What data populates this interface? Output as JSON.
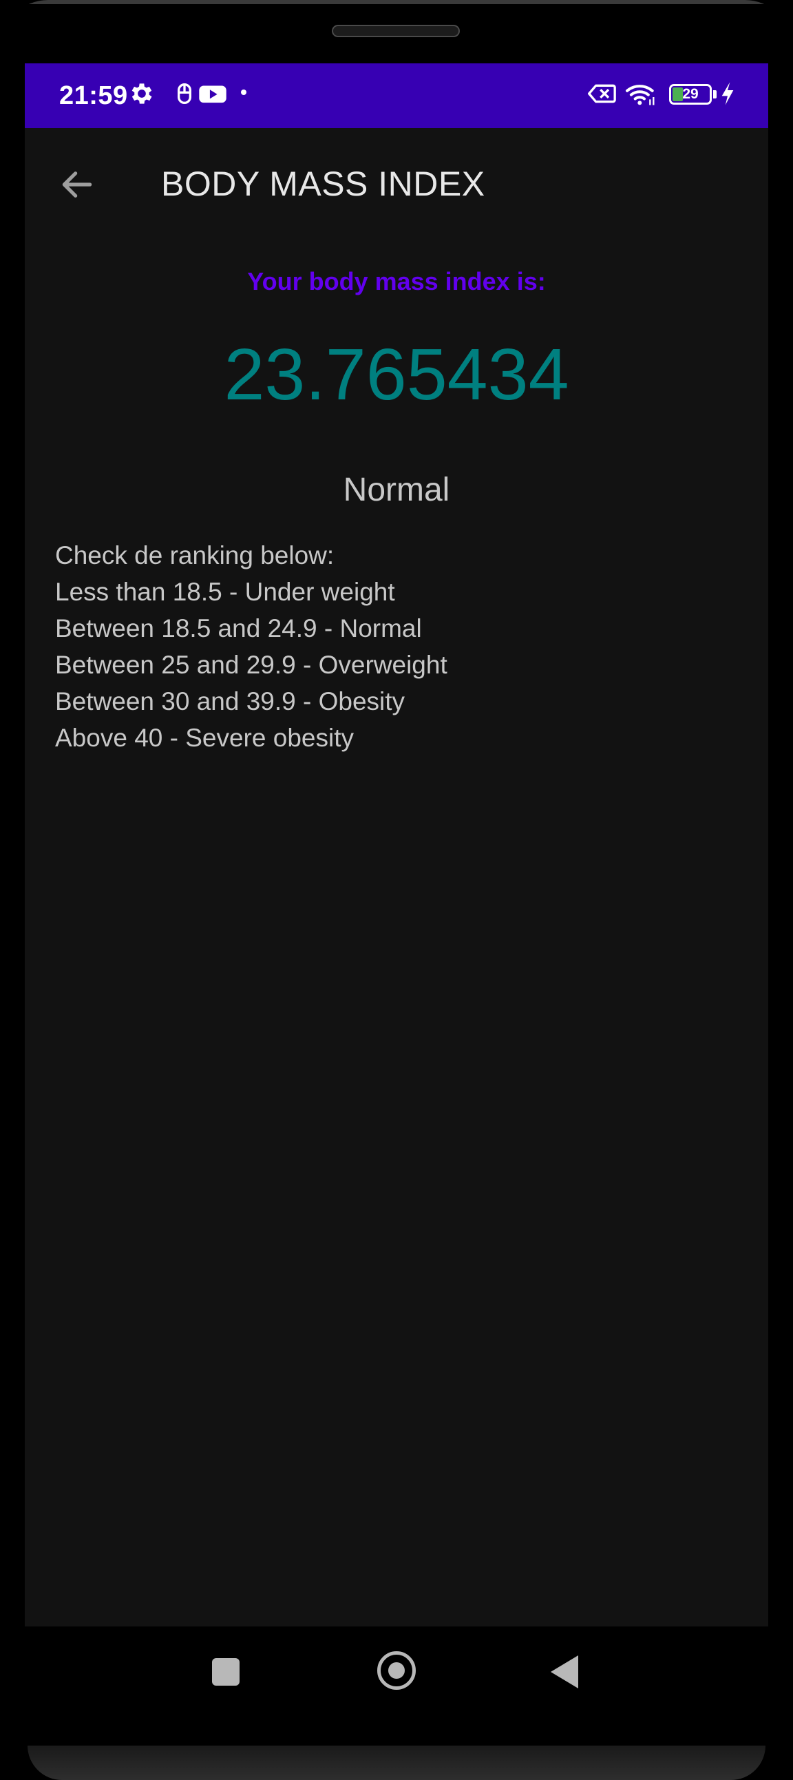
{
  "status_bar": {
    "time": "21:59",
    "battery_level": "29",
    "battery_fill_fraction": 0.29,
    "background_color": "#3700b3",
    "icons": [
      "gear-icon",
      "app-notification-icon",
      "youtube-icon",
      "notification-dot",
      "no-sim-icon",
      "wifi-icon",
      "battery-icon",
      "charging-icon"
    ]
  },
  "app_bar": {
    "title": "BODY MASS INDEX",
    "back_icon": "arrow-back-icon"
  },
  "result": {
    "subtitle": "Your body mass index is:",
    "bmi_value": "23.765434",
    "classification": "Normal"
  },
  "ranking": {
    "heading": "Check de ranking below:",
    "lines": [
      "Less than 18.5 - Under weight",
      "Between 18.5 and 24.9 - Normal",
      "Between 25 and 29.9 - Overweight",
      "Between 30 and 39.9 - Obesity",
      "Above 40 - Severe obesity"
    ]
  },
  "nav_bar": {
    "buttons": [
      "recents-square-icon",
      "home-circle-icon",
      "back-triangle-icon"
    ]
  },
  "colors": {
    "accent": "#6200ee",
    "bmi_value": "#008080",
    "screen_background": "#121212",
    "status_bar": "#3700b3"
  }
}
